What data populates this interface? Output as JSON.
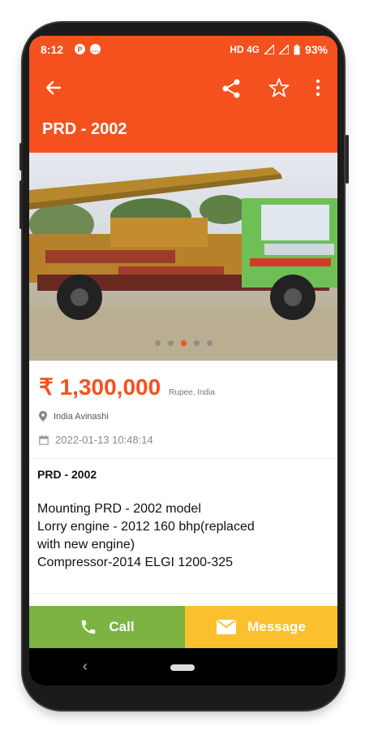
{
  "status_bar": {
    "time": "8:12",
    "network": "HD 4G",
    "battery": "93%"
  },
  "app_bar": {
    "title": "PRD - 2002",
    "icons": [
      "back-arrow-icon",
      "share-icon",
      "star-outline-icon",
      "more-vert-icon"
    ]
  },
  "gallery": {
    "image": "drilling-rig-truck-photo",
    "dot_count": 5,
    "active_dot": 3
  },
  "listing": {
    "price": "₹ 1,300,000",
    "currency_note": "Rupee, India",
    "location": "India Avinashi",
    "date": "2022-01-13 10:48:14",
    "title": "PRD - 2002",
    "description_lines": [
      "Mounting PRD - 2002 model",
      "Lorry engine - 2012 160 bhp(replaced",
      "with new engine)",
      "Compressor-2014 ELGI 1200-325"
    ]
  },
  "actions": {
    "call_label": "Call",
    "message_label": "Message"
  },
  "colors": {
    "primary": "#f4511e",
    "call": "#7cb342",
    "message": "#fbc02d"
  }
}
